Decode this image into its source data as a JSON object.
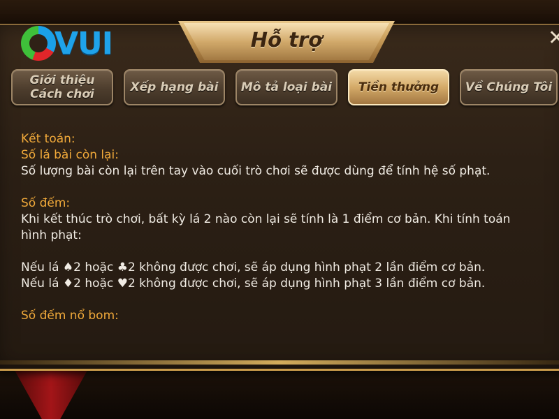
{
  "brand": {
    "logo_text": "VUI"
  },
  "header": {
    "title": "Hỗ trợ",
    "close_icon": "close-icon"
  },
  "tabs": [
    {
      "line1": "Giới thiệu",
      "line2": "Cách chơi",
      "active": false
    },
    {
      "label": "Xếp hạng bài",
      "active": false
    },
    {
      "label": "Mô tả loại bài",
      "active": false
    },
    {
      "label": "Tiền thưởng",
      "active": true
    },
    {
      "label": "Về Chúng Tôi",
      "active": false
    }
  ],
  "content": {
    "settlement_heading": "Kết toán:",
    "remaining_heading": "Số lá bài còn lại:",
    "remaining_text": "Số lượng bài còn lại trên tay vào cuối trò chơi sẽ được dùng để tính hệ số phạt.",
    "count_heading": "Số đếm:",
    "count_text_1": "Khi kết thúc trò chơi, bất kỳ lá 2 nào còn lại sẽ tính là 1 điểm cơ bản. Khi tính toán",
    "count_text_2": "hình phạt:",
    "rule_1": "Nếu lá ♠2 hoặc ♣2 không được chơi, sẽ áp dụng hình phạt 2 lần điểm cơ bản.",
    "rule_2": "Nếu lá ♦2 hoặc ♥2 không được chơi, sẽ áp dụng hình phạt 3 lần điểm cơ bản.",
    "bomb_heading": "Số đếm nổ bom:"
  },
  "colors": {
    "heading": "#f0a93a",
    "body_text": "#f1ece4",
    "logo_blue": "#1fa3ea",
    "active_tab": "#d4aa68"
  }
}
